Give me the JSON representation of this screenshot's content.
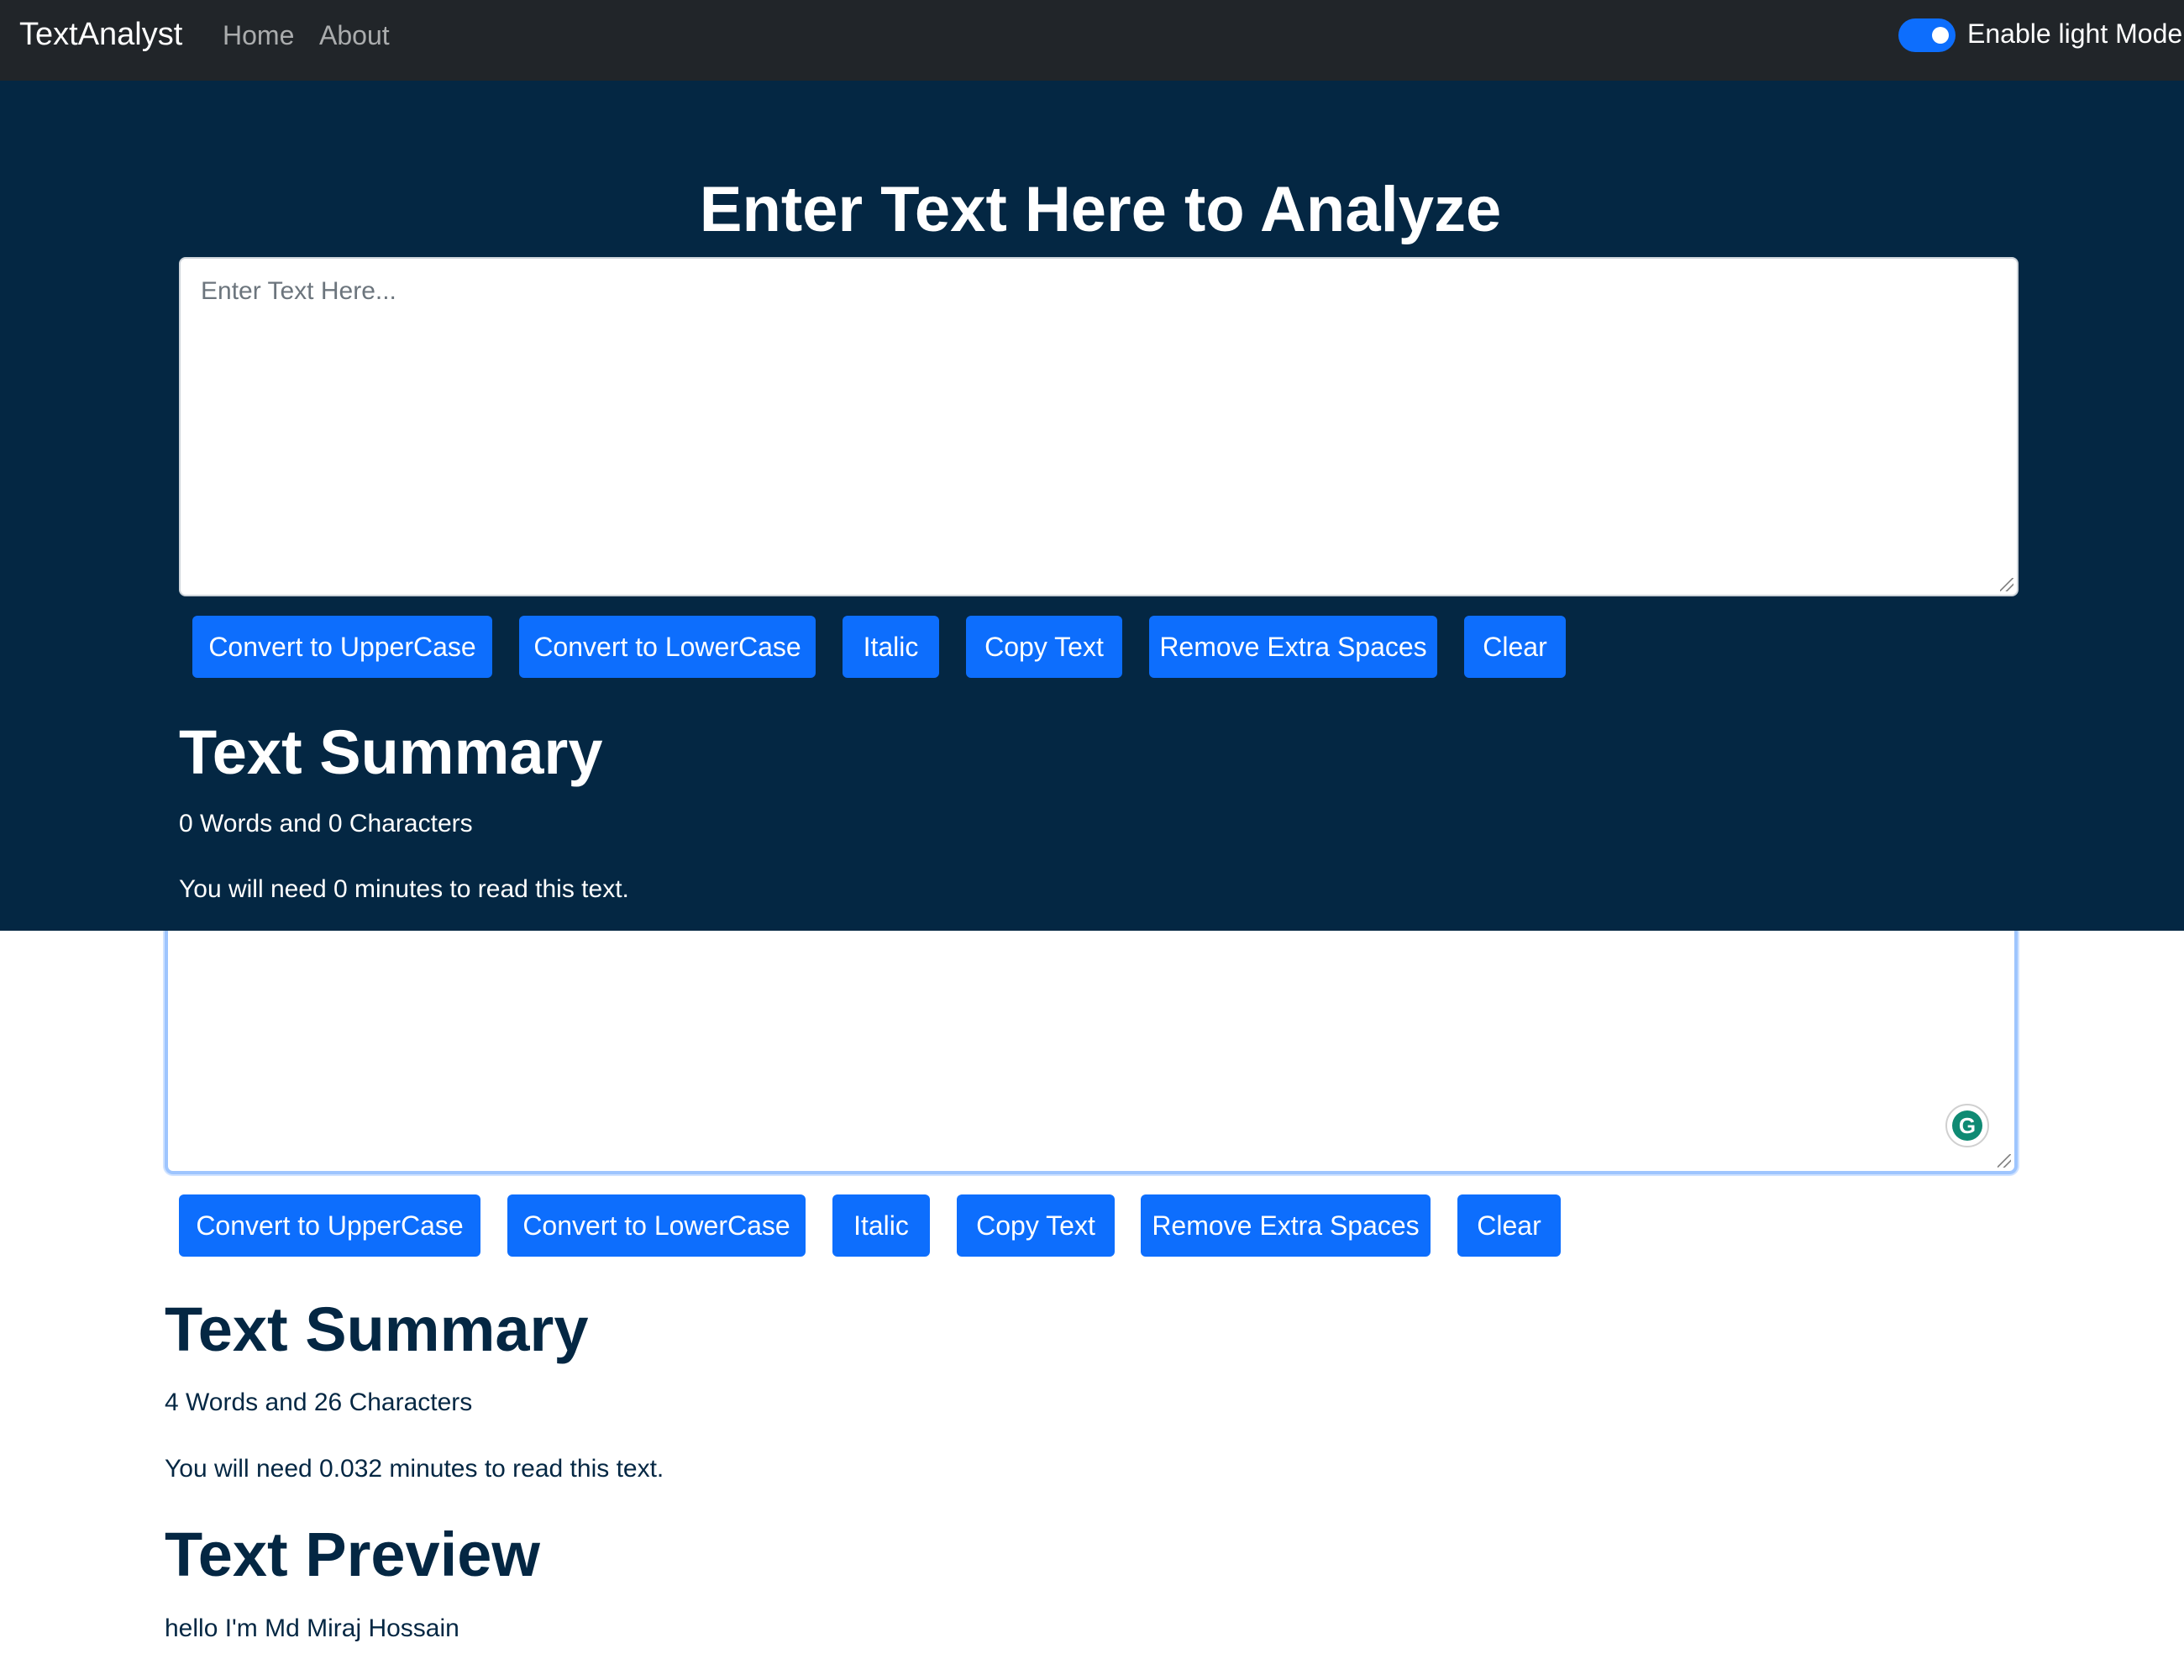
{
  "navbar": {
    "brand": "TextAnalyst",
    "links": [
      "Home",
      "About"
    ],
    "mode_toggle_label": "Enable light Mode",
    "mode_toggle_on": true
  },
  "dark_section": {
    "heading": "Enter Text Here to Analyze",
    "textarea_placeholder": "Enter Text Here...",
    "buttons": [
      "Convert to UpperCase",
      "Convert to LowerCase",
      "Italic",
      "Copy Text",
      "Remove Extra Spaces",
      "Clear"
    ],
    "summary_heading": "Text Summary",
    "word_char_count": "0 Words and 0 Characters",
    "read_time": "You will need 0 minutes to read this text."
  },
  "light_section": {
    "buttons": [
      "Convert to UpperCase",
      "Convert to LowerCase",
      "Italic",
      "Copy Text",
      "Remove Extra Spaces",
      "Clear"
    ],
    "summary_heading": "Text Summary",
    "word_char_count": "4 Words and 26 Characters",
    "read_time": "You will need 0.032 minutes to read this text.",
    "preview_heading": "Text Preview",
    "preview_text": "hello I'm Md Miraj Hossain",
    "grammarly_icon": "G"
  },
  "colors": {
    "navbar_bg": "#212529",
    "dark_bg": "#042743",
    "primary_button": "#0d6efd",
    "light_text": "#042743"
  }
}
